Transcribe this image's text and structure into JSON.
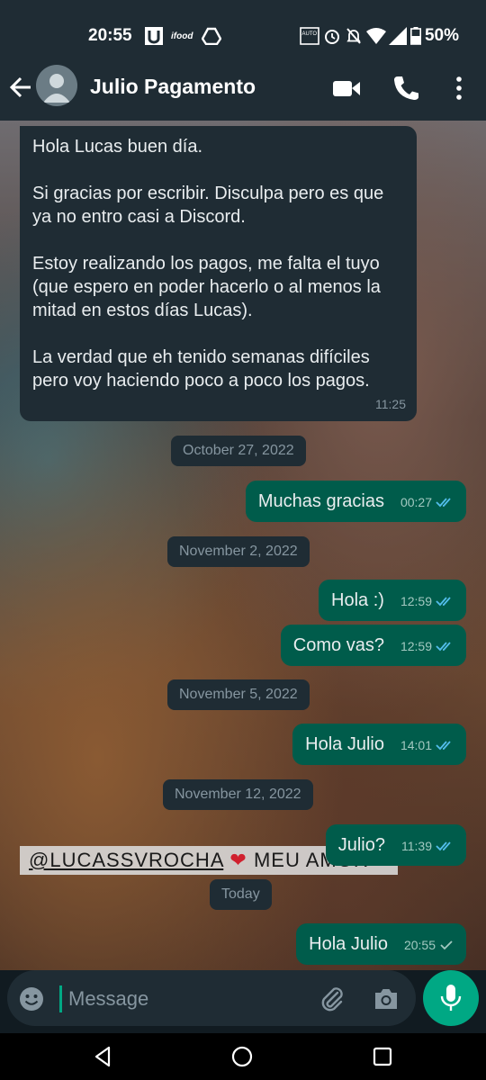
{
  "status_bar": {
    "time": "20:55",
    "battery": "50%",
    "icons": [
      "u-app-icon",
      "ifood-icon",
      "drive-icon",
      "auto-hd-icon",
      "alarm-icon",
      "mute-icon",
      "wifi-icon",
      "signal-icon",
      "battery-icon"
    ],
    "ifood_text": "ifood",
    "auto_text": "AUTO"
  },
  "header": {
    "contact_name": "Julio Pagamento",
    "icons": [
      "back-arrow-icon",
      "avatar",
      "video-call-icon",
      "voice-call-icon",
      "more-vertical-icon"
    ]
  },
  "messages": [
    {
      "type": "incoming",
      "text": "Hola Lucas buen día.\n\nSi gracias por escribir. Disculpa pero es que ya no entro casi a Discord.\n\nEstoy realizando los pagos, me falta el tuyo (que espero en poder hacerlo o al menos la mitad en estos días Lucas).\n\nLa verdad que eh tenido semanas difíciles pero voy haciendo poco a poco los pagos.",
      "time": "11:25"
    },
    {
      "type": "date",
      "text": "October 27, 2022"
    },
    {
      "type": "outgoing",
      "text": "Muchas gracias",
      "time": "00:27",
      "status": "read"
    },
    {
      "type": "date",
      "text": "November 2, 2022"
    },
    {
      "type": "outgoing",
      "text": "Hola :)",
      "time": "12:59",
      "status": "read"
    },
    {
      "type": "outgoing",
      "text": "Como vas?",
      "time": "12:59",
      "status": "read"
    },
    {
      "type": "date",
      "text": "November 5, 2022"
    },
    {
      "type": "outgoing",
      "text": "Hola Julio",
      "time": "14:01",
      "status": "read"
    },
    {
      "type": "date",
      "text": "November 12, 2022"
    },
    {
      "type": "outgoing",
      "text": "Julio?",
      "time": "11:39",
      "status": "read"
    },
    {
      "type": "date",
      "text": "Today"
    },
    {
      "type": "outgoing",
      "text": "Hola Julio",
      "time": "20:55",
      "status": "sent"
    }
  ],
  "wallpaper_sticker": {
    "handle": "@LUCASSVROCHA",
    "text": "MEU AMOR"
  },
  "compose": {
    "placeholder": "Message",
    "value": ""
  },
  "colors": {
    "header": "#1f2c34",
    "incoming_bubble": "#1f2c34",
    "outgoing_bubble": "#005c4b",
    "accent": "#00a884",
    "read_ticks": "#53bdeb"
  }
}
